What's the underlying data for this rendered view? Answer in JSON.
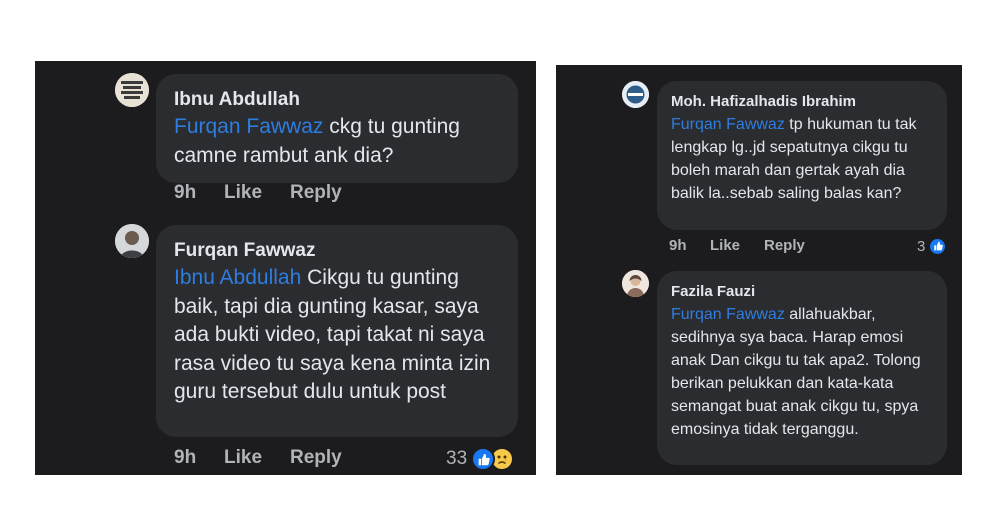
{
  "left": {
    "comment1": {
      "author": "Ibnu Abdullah",
      "mention": "Furqan Fawwaz",
      "text": " ckg tu gunting camne rambut ank dia?",
      "time": "9h",
      "like_label": "Like",
      "reply_label": "Reply"
    },
    "comment2": {
      "author": "Furqan Fawwaz",
      "mention": "Ibnu Abdullah",
      "text": " Cikgu tu gunting baik, tapi dia gunting kasar, saya ada bukti video, tapi takat ni saya rasa video tu saya kena minta izin guru tersebut dulu untuk post",
      "time": "9h",
      "like_label": "Like",
      "reply_label": "Reply",
      "reaction_count": "33",
      "reaction_icons": [
        "like-icon",
        "sad-icon"
      ]
    }
  },
  "right": {
    "comment1": {
      "author": "Moh. Hafizalhadis Ibrahim",
      "mention": "Furqan Fawwaz",
      "text": " tp hukuman tu tak lengkap lg..jd sepatutnya cikgu tu boleh marah dan gertak ayah dia balik la..sebab saling balas kan?",
      "time": "9h",
      "like_label": "Like",
      "reply_label": "Reply",
      "reaction_count": "3",
      "reaction_icons": [
        "like-icon"
      ]
    },
    "comment2": {
      "author": "Fazila Fauzi",
      "mention": "Furqan Fawwaz",
      "text": " allahuakbar, sedihnya sya baca. Harap emosi anak Dan cikgu tu tak apa2. Tolong berikan pelukkan dan kata-kata semangat buat anak cikgu tu, spya emosinya tidak terganggu."
    }
  },
  "colors": {
    "panel_bg": "#1c1c1e",
    "bubble_bg": "#2b2c2f",
    "text": "#e4e6eb",
    "mention": "#2e7de0",
    "meta": "#b0b3b8",
    "like_blue": "#1877f2",
    "sad_yellow": "#f7c94b"
  }
}
